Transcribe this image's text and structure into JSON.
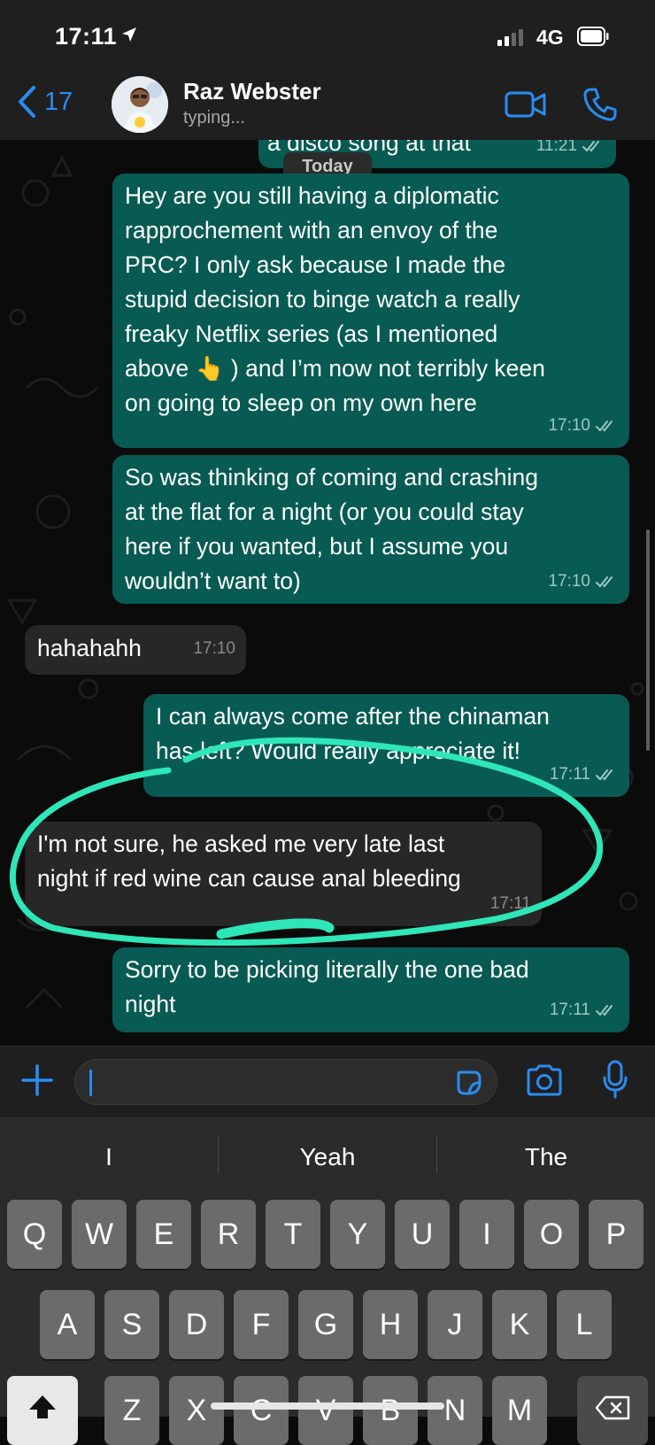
{
  "status_bar": {
    "time": "17:11",
    "network": "4G"
  },
  "header": {
    "back_count": "17",
    "contact_name": "Raz Webster",
    "contact_status": "typing..."
  },
  "chat": {
    "date_chip": "Today",
    "messages": [
      {
        "dir": "out",
        "text": "a disco song at that",
        "time": "11:21"
      },
      {
        "dir": "out",
        "text": "Hey are you still having a diplomatic\nrapprochement with an envoy of the\nPRC? I only ask because I made the\nstupid decision to binge watch a really\nfreaky Netflix series (as I mentioned\nabove 👆 ) and I’m now not terribly keen\non going to sleep on my own here",
        "time": "17:10"
      },
      {
        "dir": "out",
        "text": "So was thinking of coming and crashing\nat the flat for a night (or you could stay\nhere if you wanted, but I assume you\nwouldn’t want to)",
        "time": "17:10"
      },
      {
        "dir": "in",
        "text": "hahahahh",
        "time": "17:10"
      },
      {
        "dir": "out",
        "text": "I can always come after the chinaman\nhas left? Would really appreciate it!",
        "time": "17:11"
      },
      {
        "dir": "in",
        "text": "I'm not sure, he asked me very late last\nnight if red wine can cause anal bleeding",
        "time": "17:11"
      },
      {
        "dir": "out",
        "text": "Sorry to be picking literally the one bad\nnight",
        "time": "17:11"
      }
    ]
  },
  "composer": {
    "input_value": ""
  },
  "keyboard": {
    "suggestions": [
      "I",
      "Yeah",
      "The"
    ],
    "row1": [
      "Q",
      "W",
      "E",
      "R",
      "T",
      "Y",
      "U",
      "I",
      "O",
      "P"
    ],
    "row2": [
      "A",
      "S",
      "D",
      "F",
      "G",
      "H",
      "J",
      "K",
      "L"
    ],
    "row3": [
      "Z",
      "X",
      "C",
      "V",
      "B",
      "N",
      "M"
    ]
  },
  "colors": {
    "accent": "#2a8cf0",
    "outgoing_bubble": "#075b53",
    "incoming_bubble": "#272727",
    "highlight_circle": "#2fe6b9"
  },
  "icons": {
    "back": "chevron-left-icon",
    "video": "video-camera-icon",
    "call": "phone-icon",
    "attach": "plus-icon",
    "sticker": "sticker-icon",
    "camera": "camera-icon",
    "mic": "microphone-icon",
    "read_receipt": "double-check-icon",
    "shift": "shift-arrow-icon",
    "backspace": "backspace-icon"
  }
}
